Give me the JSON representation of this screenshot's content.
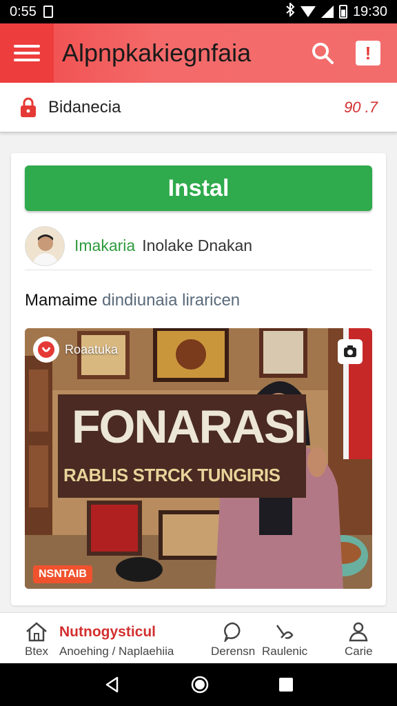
{
  "status_bar": {
    "time": "0:55",
    "clock": "19:30"
  },
  "app_bar": {
    "title": "Alpnpkakiegnfaia",
    "search_icon": "search-icon",
    "alert_label": "!"
  },
  "secure_bar": {
    "label": "Bidanecia",
    "value": "90 .7",
    "color": "#d32f2f"
  },
  "card": {
    "install_label": "Instal",
    "developer": {
      "name": "Imakaria",
      "label": "Inolake Dnakan"
    },
    "description": {
      "strong": "Mamaime",
      "light": "dindiunaia liraricen"
    },
    "media": {
      "channel_name": "Roaatuka",
      "banner_big": "FONARASI",
      "banner_small": "RABLIS STRCK TUNGIRIS",
      "badge": "NSNTAIB"
    }
  },
  "bottom_nav": {
    "home": {
      "label": "Btex",
      "icon": "home-icon"
    },
    "center": {
      "title": "Nutnogysticul",
      "sub": "Anoehing / Naplaehiia"
    },
    "chat": {
      "label": "Derensn",
      "icon": "chat-icon"
    },
    "tools": {
      "label": "Raulenic",
      "icon": "tools-icon"
    },
    "profile": {
      "label": "Carie",
      "icon": "person-icon"
    }
  },
  "colors": {
    "accent": "#f04848",
    "install": "#2faa4c",
    "developer": "#2e9a3d"
  }
}
